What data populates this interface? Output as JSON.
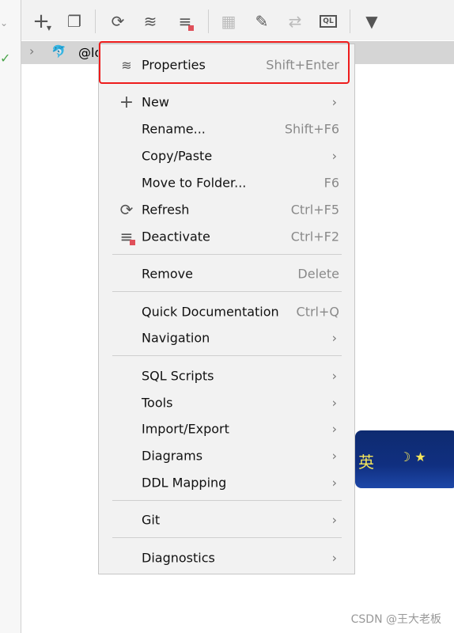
{
  "tree": {
    "node_label": "@lo"
  },
  "toolbar": {
    "icons": [
      "add-icon",
      "duplicate-icon",
      "refresh-icon",
      "properties-icon",
      "deactivate-icon",
      "table-icon",
      "edit-icon",
      "compare-icon",
      "console-ql-icon",
      "filter-icon"
    ],
    "ql_label": "QL"
  },
  "menu": {
    "items": [
      {
        "label": "Properties",
        "shortcut": "Shift+Enter",
        "icon": "properties-icon"
      },
      {
        "label": "New",
        "submenu": true,
        "icon": "plus-icon"
      },
      {
        "label": "Rename...",
        "shortcut": "Shift+F6"
      },
      {
        "label": "Copy/Paste",
        "submenu": true
      },
      {
        "label": "Move to Folder...",
        "shortcut": "F6"
      },
      {
        "label": "Refresh",
        "shortcut": "Ctrl+F5",
        "icon": "refresh-icon"
      },
      {
        "label": "Deactivate",
        "shortcut": "Ctrl+F2",
        "icon": "deactivate-icon"
      },
      {
        "label": "Remove",
        "shortcut": "Delete"
      },
      {
        "label": "Quick Documentation",
        "shortcut": "Ctrl+Q"
      },
      {
        "label": "Navigation",
        "submenu": true
      },
      {
        "label": "SQL Scripts",
        "submenu": true
      },
      {
        "label": "Tools",
        "submenu": true
      },
      {
        "label": "Import/Export",
        "submenu": true
      },
      {
        "label": "Diagrams",
        "submenu": true
      },
      {
        "label": "DDL Mapping",
        "submenu": true
      },
      {
        "label": "Git",
        "submenu": true
      },
      {
        "label": "Diagnostics",
        "submenu": true
      }
    ],
    "arrow": "›"
  },
  "banner": {
    "text": "英"
  },
  "watermark": "CSDN @王大老板",
  "colors": {
    "highlight": "#ee1c1c",
    "accent_red": "#e0505a"
  }
}
